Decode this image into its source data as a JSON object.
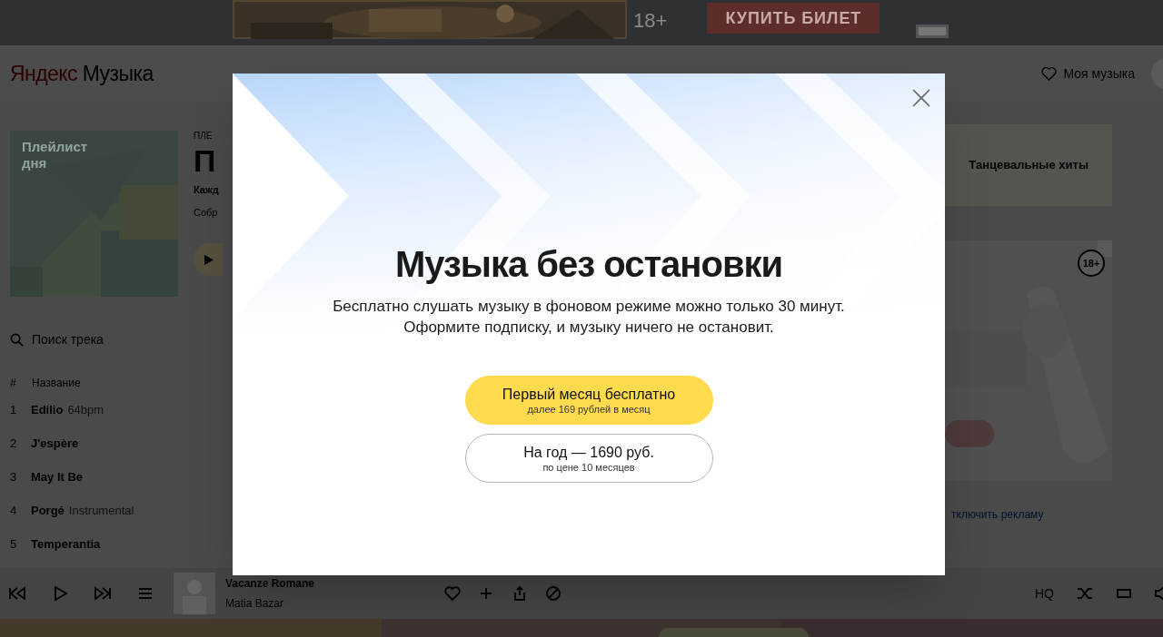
{
  "ad_banner": {
    "age_mark": "18+",
    "button": "КУПИТЬ БИЛЕТ"
  },
  "header": {
    "logo_first": "Яндекс",
    "logo_second": "Музыка",
    "my_music": "Моя музыка"
  },
  "playlist": {
    "cover_title": "Плейлист дня",
    "label": "ПЛЕ",
    "title": "П",
    "line_1": "Кажд",
    "line_2": "Собр"
  },
  "track_search": {
    "placeholder": "Поиск трека"
  },
  "track_table": {
    "columns": [
      "#",
      "Название"
    ],
    "rows": [
      {
        "number": "1",
        "title": "Edilio",
        "version": "64bpm"
      },
      {
        "number": "2",
        "title": "J'espère"
      },
      {
        "number": "3",
        "title": "May It Be"
      },
      {
        "number": "4",
        "title": "Porgé",
        "version": "Instrumental"
      },
      {
        "number": "5",
        "title": "Temperantia"
      }
    ]
  },
  "side_card": {
    "title": "Танцевальные хиты"
  },
  "side_ad": {
    "kind": "picture",
    "age_mark": "18+",
    "link": "тключить рекламу"
  },
  "player": {
    "track": "Vacanze Romane",
    "artist": "Matia Bazar",
    "quality": "HQ"
  },
  "modal": {
    "title": "Музыка без остановки",
    "text": "Бесплатно слушать музыку в фоновом режиме можно только 30 минут.\nОформите подписку, и музыку ничего не остановит.",
    "buttons": [
      {
        "kind": "primary",
        "label": "Первый месяц бесплатно",
        "note": "далее 169 рублей в месяц"
      },
      {
        "kind": "secondary",
        "label": "На год — 1690 руб.",
        "note": "по цене 10 месяцев"
      }
    ]
  }
}
